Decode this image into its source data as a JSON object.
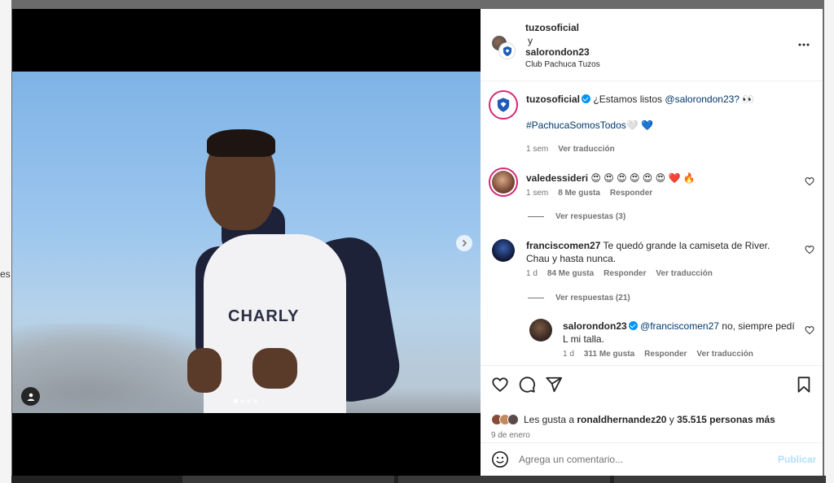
{
  "backdrop": {
    "side_text": "es"
  },
  "post": {
    "carousel": {
      "total": 4,
      "active": 0
    },
    "jersey_text": "CHARLY"
  },
  "header": {
    "author": "tuzosoficial",
    "conjunction": "y",
    "coauthor": "salorondon23",
    "location": "Club Pachuca Tuzos"
  },
  "caption": {
    "author": "tuzosoficial",
    "text": "¿Estamos listos",
    "mention": "@salorondon23?",
    "emoji": "👀",
    "hashtag": "#PachucaSomosTodos",
    "hashtag_emoji": "🤍 💙",
    "time": "1 sem",
    "translate": "Ver traducción"
  },
  "comments": [
    {
      "user": "valedessideri",
      "text": "😍 😍 😍 😍 😍 😍 ❤️ 🔥",
      "time": "1 sem",
      "likes": "8 Me gusta",
      "reply": "Responder",
      "view_replies": "Ver respuestas (3)"
    },
    {
      "user": "franciscomen27",
      "text": "Te quedó grande la camiseta de River. Chau y hasta nunca.",
      "time": "1 d",
      "likes": "84 Me gusta",
      "reply": "Responder",
      "translate": "Ver traducción",
      "view_replies": "Ver respuestas (21)"
    },
    {
      "user": "salorondon23",
      "mention": "@franciscomen27",
      "text": "no, siempre pedí L mi talla.",
      "time": "1 d",
      "likes": "311 Me gusta",
      "reply": "Responder",
      "translate": "Ver traducción"
    }
  ],
  "likes": {
    "prefix": "Les gusta a",
    "user": "ronaldhernandez20",
    "middle": "y",
    "count": "35.515 personas más"
  },
  "date": "9 de enero",
  "composer": {
    "placeholder": "Agrega un comentario...",
    "post_label": "Publicar"
  },
  "colors": {
    "verified": "#0095f6",
    "link": "#00376b",
    "post_disabled": "#b2dffc",
    "story_ring": "#d62976"
  }
}
